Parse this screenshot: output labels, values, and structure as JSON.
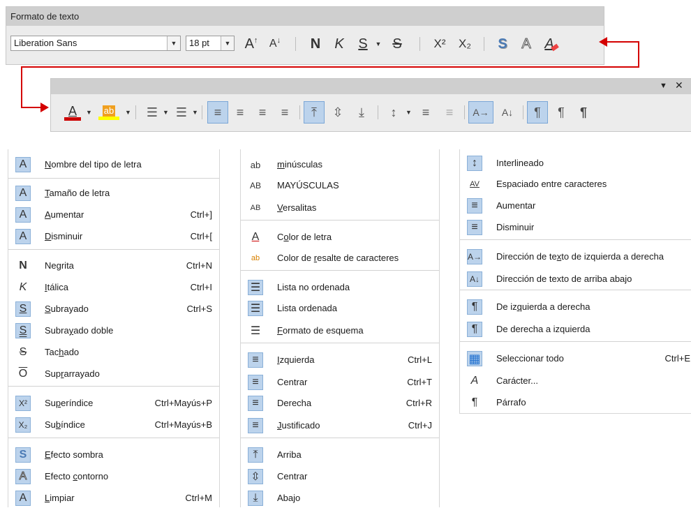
{
  "toolbar1": {
    "title": "Formato de texto",
    "font_name": "Liberation Sans",
    "font_size": "18 pt",
    "glyph_a": "A",
    "glyph_bold": "N",
    "glyph_italic": "K",
    "glyph_underline": "S",
    "glyph_strike": "S",
    "glyph_super": "X²",
    "glyph_sub": "X₂",
    "glyph_shadow": "S",
    "glyph_outline": "A"
  },
  "toolbar2": {
    "glyph_font_color": "A",
    "glyph_highlight": "ab"
  },
  "colors": {
    "accent_red": "#d40000",
    "highlight_blue": "#bcd3ec",
    "font_color_bar": "#cc0000",
    "highlight_bar": "#ffff00"
  },
  "menu1": [
    {
      "icon": "font-name-icon",
      "glyph": "A",
      "pre": "",
      "ul": "N",
      "post": "ombre del tipo de letra",
      "sc": ""
    },
    {
      "icon": "font-size-icon",
      "glyph": "A",
      "pre": "",
      "ul": "T",
      "post": "amaño de letra",
      "sc": ""
    },
    {
      "icon": "grow-icon",
      "glyph": "A",
      "pre": "",
      "ul": "A",
      "post": "umentar",
      "sc": "Ctrl+]"
    },
    {
      "icon": "shrink-icon",
      "glyph": "A",
      "pre": "",
      "ul": "D",
      "post": "isminuir",
      "sc": "Ctrl+["
    },
    {
      "icon": "bold-icon",
      "glyph": "N",
      "pre": "Negrita",
      "ul": "",
      "post": "",
      "sc": "Ctrl+N"
    },
    {
      "icon": "italic-icon",
      "glyph": "K",
      "pre": "",
      "ul": "I",
      "post": "tálica",
      "sc": "Ctrl+I"
    },
    {
      "icon": "underline-icon",
      "glyph": "S",
      "pre": "",
      "ul": "S",
      "post": "ubrayado",
      "sc": "Ctrl+S"
    },
    {
      "icon": "double-underline-icon",
      "glyph": "S",
      "pre": "Subra",
      "ul": "y",
      "post": "ado doble",
      "sc": ""
    },
    {
      "icon": "strikethrough-icon",
      "glyph": "S",
      "pre": "Tac",
      "ul": "h",
      "post": "ado",
      "sc": ""
    },
    {
      "icon": "overline-icon",
      "glyph": "O",
      "pre": "Sup",
      "ul": "r",
      "post": "arrayado",
      "sc": ""
    },
    {
      "icon": "superscript-icon",
      "glyph": "X²",
      "pre": "Su",
      "ul": "p",
      "post": "eríndice",
      "sc": "Ctrl+Mayús+P"
    },
    {
      "icon": "subscript-icon",
      "glyph": "X₂",
      "pre": "Su",
      "ul": "b",
      "post": "índice",
      "sc": "Ctrl+Mayús+B"
    },
    {
      "icon": "shadow-icon",
      "glyph": "S",
      "pre": "",
      "ul": "E",
      "post": "fecto sombra",
      "sc": ""
    },
    {
      "icon": "outline-icon",
      "glyph": "A",
      "pre": "Efecto ",
      "ul": "c",
      "post": "ontorno",
      "sc": ""
    },
    {
      "icon": "clear-format-icon",
      "glyph": "A",
      "pre": "",
      "ul": "L",
      "post": "impiar",
      "sc": "Ctrl+M"
    }
  ],
  "menu2": [
    {
      "icon": "lowercase-icon",
      "glyph": "ab",
      "pre": "",
      "ul": "m",
      "post": "inúsculas",
      "sc": ""
    },
    {
      "icon": "uppercase-icon",
      "glyph": "AB",
      "pre": "MAYÚSCULAS",
      "ul": "",
      "post": "",
      "sc": ""
    },
    {
      "icon": "small-caps-icon",
      "glyph": "AB",
      "pre": "",
      "ul": "V",
      "post": "ersalitas",
      "sc": ""
    },
    {
      "icon": "font-color-icon",
      "glyph": "A",
      "pre": "C",
      "ul": "o",
      "post": "lor de letra",
      "sc": ""
    },
    {
      "icon": "char-highlight-icon",
      "glyph": "ab",
      "pre": "Color de ",
      "ul": "r",
      "post": "esalte de caracteres",
      "sc": ""
    },
    {
      "icon": "unordered-list-icon",
      "glyph": "☰",
      "pre": "Lista no ordenada",
      "ul": "",
      "post": "",
      "sc": ""
    },
    {
      "icon": "ordered-list-icon",
      "glyph": "☰",
      "pre": "Lista ordenada",
      "ul": "",
      "post": "",
      "sc": ""
    },
    {
      "icon": "outline-format-icon",
      "glyph": "☰",
      "pre": "",
      "ul": "F",
      "post": "ormato de esquema",
      "sc": ""
    },
    {
      "icon": "align-left-icon",
      "glyph": "≡",
      "pre": "",
      "ul": "I",
      "post": "zquierda",
      "sc": "Ctrl+L"
    },
    {
      "icon": "align-center-icon",
      "glyph": "≡",
      "pre": "Centrar",
      "ul": "",
      "post": "",
      "sc": "Ctrl+T"
    },
    {
      "icon": "align-right-icon",
      "glyph": "≡",
      "pre": "Derecha",
      "ul": "",
      "post": "",
      "sc": "Ctrl+R"
    },
    {
      "icon": "justify-icon",
      "glyph": "≡",
      "pre": "",
      "ul": "J",
      "post": "ustificado",
      "sc": "Ctrl+J"
    },
    {
      "icon": "align-top-icon",
      "glyph": "⤒",
      "pre": "Arriba",
      "ul": "",
      "post": "",
      "sc": ""
    },
    {
      "icon": "align-middle-icon",
      "glyph": "⇳",
      "pre": "Centrar",
      "ul": "",
      "post": "",
      "sc": ""
    },
    {
      "icon": "align-bottom-icon",
      "glyph": "⤓",
      "pre": "Abajo",
      "ul": "",
      "post": "",
      "sc": ""
    }
  ],
  "menu3": [
    {
      "icon": "line-spacing-icon",
      "glyph": "↕",
      "pre": "Interlineado",
      "ul": "",
      "post": "",
      "sc": ""
    },
    {
      "icon": "char-spacing-icon",
      "glyph": "AV",
      "pre": "Espaciado entre caracteres",
      "ul": "",
      "post": "",
      "sc": ""
    },
    {
      "icon": "increase-spacing-icon",
      "glyph": "≡",
      "pre": "Aumentar",
      "ul": "",
      "post": "",
      "sc": ""
    },
    {
      "icon": "decrease-spacing-icon",
      "glyph": "≡",
      "pre": "Disminuir",
      "ul": "",
      "post": "",
      "sc": ""
    },
    {
      "icon": "text-ltr-icon",
      "glyph": "A→",
      "pre": "Dirección de te",
      "ul": "x",
      "post": "to de izquierda a derecha",
      "sc": ""
    },
    {
      "icon": "text-ttb-icon",
      "glyph": "A↓",
      "pre": "Dirección de texto de arriba abajo",
      "ul": "",
      "post": "",
      "sc": ""
    },
    {
      "icon": "paragraph-ltr-icon",
      "glyph": "¶",
      "pre": "De iz",
      "ul": "q",
      "post": "uierda a derecha",
      "sc": ""
    },
    {
      "icon": "paragraph-rtl-icon",
      "glyph": "¶",
      "pre": "De derecha a izquierda",
      "ul": "",
      "post": "",
      "sc": ""
    },
    {
      "icon": "select-all-icon",
      "glyph": "▦",
      "pre": "Seleccionar todo",
      "ul": "",
      "post": "",
      "sc": "Ctrl+E"
    },
    {
      "icon": "character-dialog-icon",
      "glyph": "A",
      "pre": "Carácter...",
      "ul": "",
      "post": "",
      "sc": ""
    },
    {
      "icon": "paragraph-dialog-icon",
      "glyph": "¶",
      "pre": "Párrafo",
      "ul": "",
      "post": "",
      "sc": ""
    }
  ]
}
